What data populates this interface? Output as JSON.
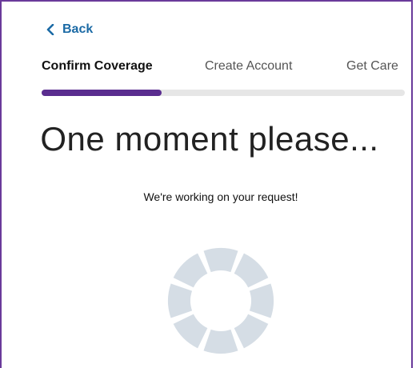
{
  "nav": {
    "back_label": "Back"
  },
  "steps": [
    {
      "label": "Confirm Coverage",
      "active": true
    },
    {
      "label": "Create Account",
      "active": false
    },
    {
      "label": "Get Care",
      "active": false
    }
  ],
  "progress": {
    "percent": 33
  },
  "main": {
    "title": "One moment please...",
    "subtitle": "We're working on your request!"
  },
  "colors": {
    "accent": "#5a2d8f",
    "link": "#1b6aa5",
    "spinner": "#d5dde5",
    "frame": "#6a3a9a"
  },
  "icons": {
    "back": "chevron-left-icon",
    "loading": "loading-spinner-icon"
  }
}
